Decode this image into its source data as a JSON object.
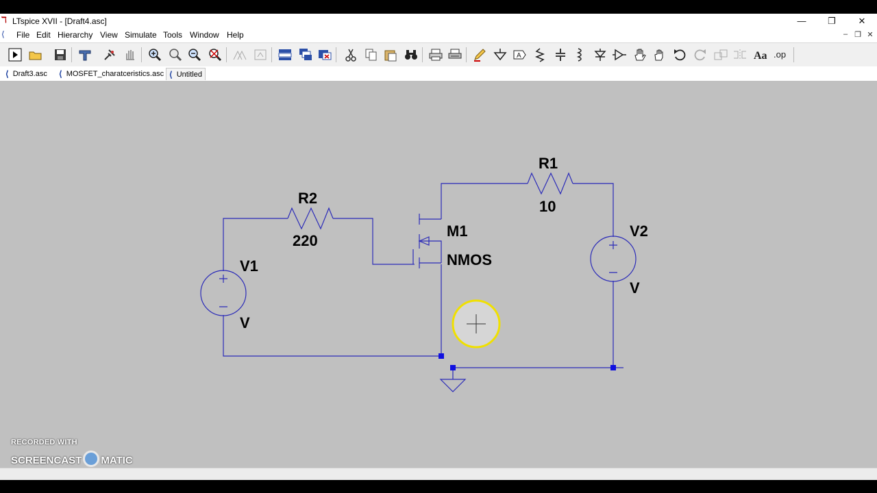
{
  "window": {
    "title": "LTspice XVII - [Draft4.asc]"
  },
  "menu": [
    {
      "label": "File"
    },
    {
      "label": "Edit"
    },
    {
      "label": "Hierarchy"
    },
    {
      "label": "View"
    },
    {
      "label": "Simulate"
    },
    {
      "label": "Tools"
    },
    {
      "label": "Window"
    },
    {
      "label": "Help"
    }
  ],
  "tabs": [
    {
      "label": "Draft3.asc"
    },
    {
      "label": "MOSFET_charatceristics.asc"
    },
    {
      "label": "Untitled"
    }
  ],
  "schematic": {
    "r1": {
      "name": "R1",
      "value": "10"
    },
    "r2": {
      "name": "R2",
      "value": "220"
    },
    "m1": {
      "name": "M1",
      "model": "NMOS"
    },
    "v1": {
      "name": "V1",
      "value": "V"
    },
    "v2": {
      "name": "V2",
      "value": "V"
    }
  },
  "colors": {
    "wire": "#2b2bb8",
    "canvas": "#c0c0c0",
    "cursor": "#f0e000",
    "junction": "#1010e0"
  },
  "watermark": {
    "line1": "RECORDED WITH",
    "line2a": "SCREENCAST",
    "line2b": "MATIC"
  }
}
